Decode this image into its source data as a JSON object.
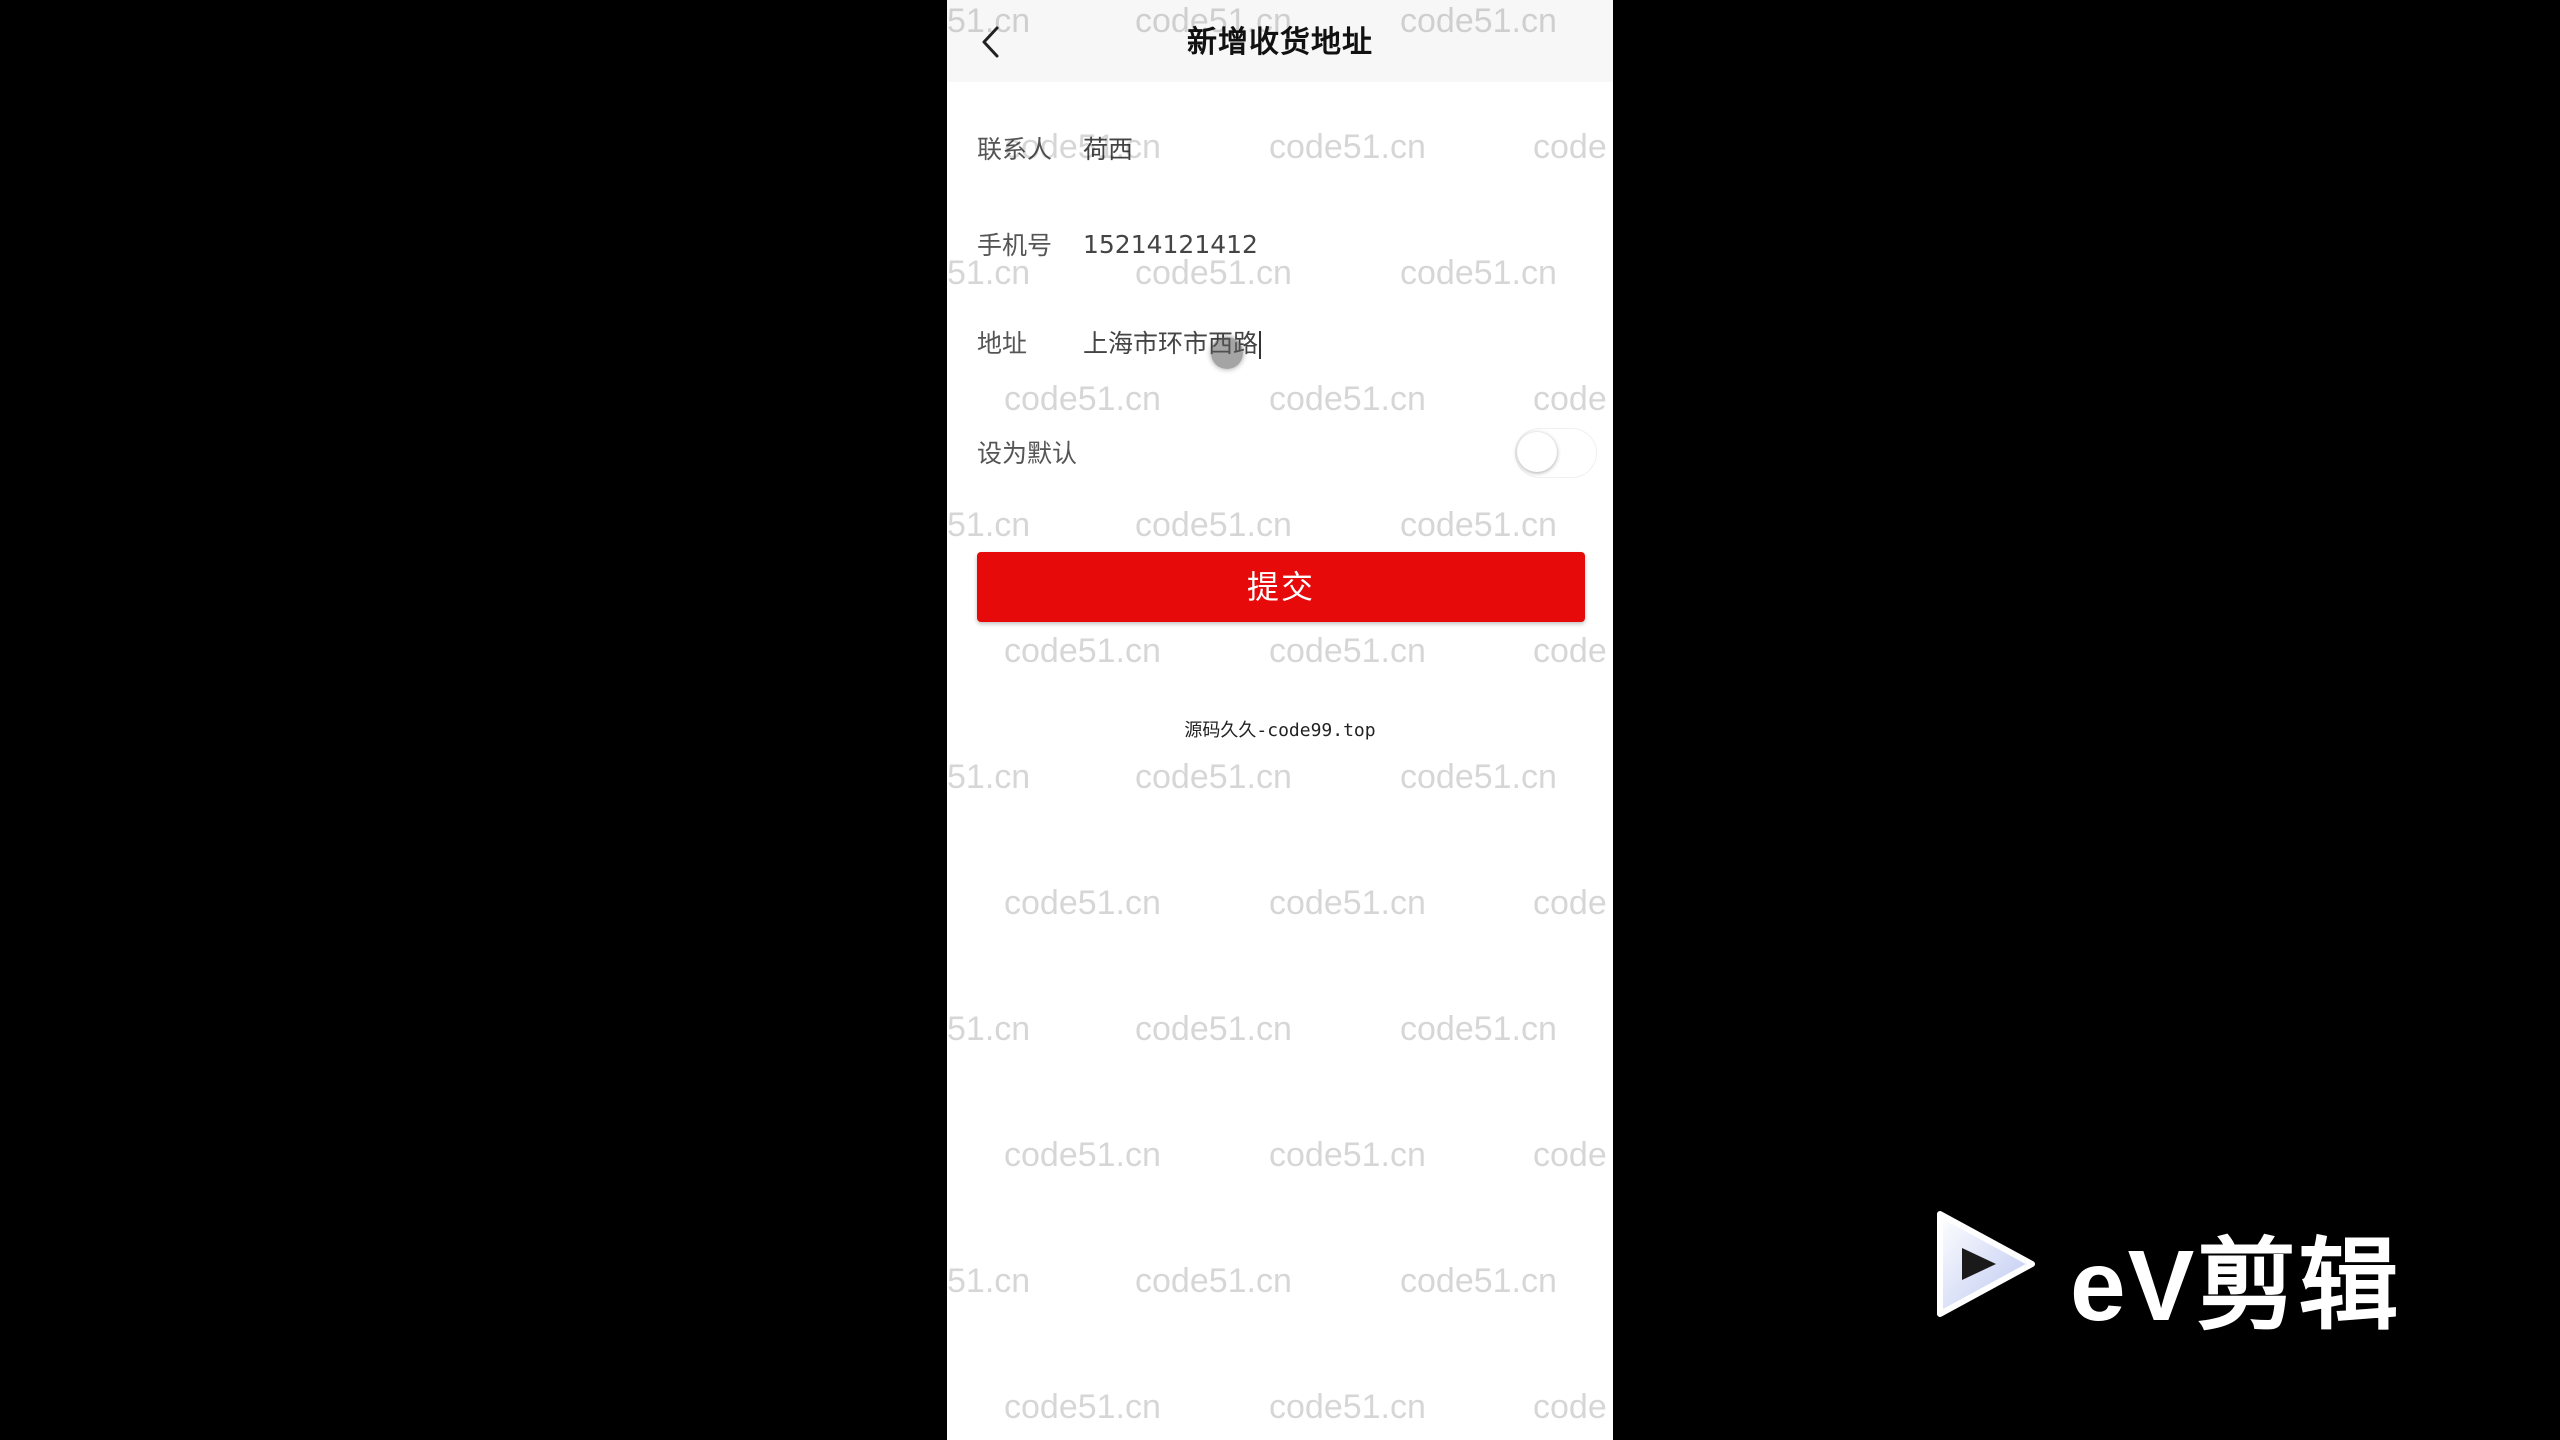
{
  "nav": {
    "title": "新增收货地址",
    "back_icon": "chevron-left-icon"
  },
  "form": {
    "contact": {
      "label": "联系人",
      "value": "荷西"
    },
    "phone": {
      "label": "手机号",
      "value": "15214121412"
    },
    "address": {
      "label": "地址",
      "value": "上海市环市西路"
    },
    "default": {
      "label": "设为默认",
      "enabled": false
    }
  },
  "submit": {
    "label": "提交",
    "color": "#e60a0a"
  },
  "footer": {
    "text": "源码久久-code99.top"
  },
  "watermark": {
    "text": "code51.cn",
    "partial_left": "51.cn",
    "partial_right": "code"
  },
  "branding": {
    "logo_text": "eV剪辑",
    "icon": "play-icon"
  }
}
